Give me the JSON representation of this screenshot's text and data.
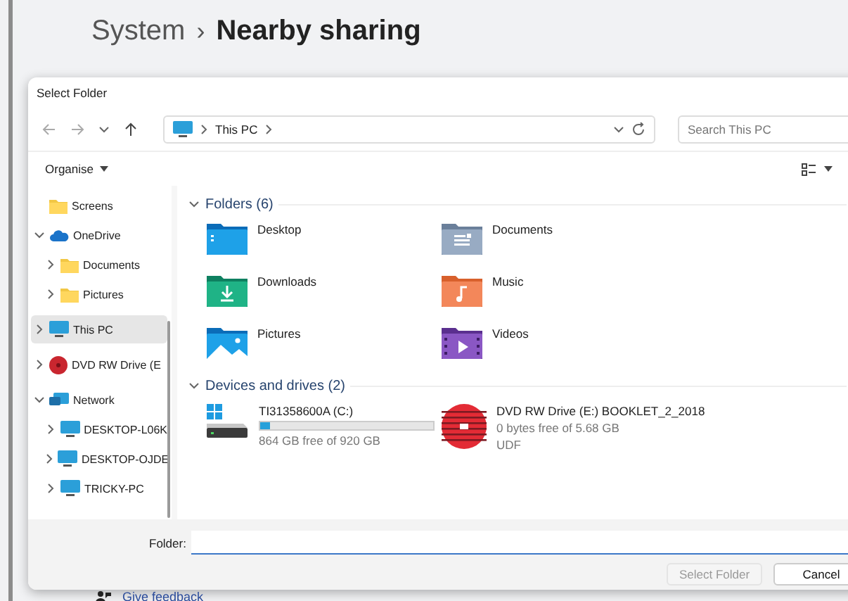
{
  "header": {
    "parent": "System",
    "separator": "›",
    "current": "Nearby sharing"
  },
  "dialog": {
    "title": "Select Folder",
    "address": {
      "location": "This PC"
    },
    "search": {
      "placeholder": "Search This PC"
    },
    "toolbar": {
      "organise": "Organise"
    },
    "sidebar": [
      {
        "label": "Screens",
        "kind": "folder",
        "selected": false
      },
      {
        "label": "OneDrive",
        "kind": "cloud",
        "selected": false,
        "expanded": true,
        "children": [
          {
            "label": "Documents",
            "kind": "folder",
            "selected": false,
            "expanded": false
          },
          {
            "label": "Pictures",
            "kind": "folder",
            "selected": false,
            "expanded": false
          }
        ]
      },
      {
        "label": "This PC",
        "kind": "pc",
        "selected": true,
        "expanded": false
      },
      {
        "label": "DVD RW Drive (E",
        "kind": "dvd",
        "selected": false,
        "expanded": false
      },
      {
        "label": "Network",
        "kind": "network",
        "selected": false,
        "expanded": true,
        "children": [
          {
            "label": "DESKTOP-L06K",
            "kind": "pc",
            "selected": false,
            "expanded": false
          },
          {
            "label": "DESKTOP-OJDE",
            "kind": "pc",
            "selected": false,
            "expanded": false
          },
          {
            "label": "TRICKY-PC",
            "kind": "pc",
            "selected": false,
            "expanded": false
          }
        ]
      }
    ],
    "folders": {
      "title": "Folders (6)",
      "items": [
        {
          "label": "Desktop",
          "kind": "desktop"
        },
        {
          "label": "Documents",
          "kind": "documents"
        },
        {
          "label": "Downloads",
          "kind": "downloads"
        },
        {
          "label": "Music",
          "kind": "music"
        },
        {
          "label": "Pictures",
          "kind": "pictures"
        },
        {
          "label": "Videos",
          "kind": "videos"
        }
      ]
    },
    "drives": {
      "title": "Devices and drives (2)",
      "items": [
        {
          "label": "TI31358600A (C:)",
          "kind": "disk",
          "level": 0.06,
          "free": "864 GB free of 920 GB"
        },
        {
          "label": "DVD RW Drive (E:) BOOKLET_2_2018",
          "kind": "dvd",
          "free": "0 bytes free of 5.68 GB",
          "format": "UDF"
        }
      ]
    },
    "footer": {
      "folder_label": "Folder:",
      "select_button": {
        "label": "Select Folder",
        "disabled": true
      },
      "cancel_button": {
        "label": "Cancel",
        "disabled": false
      }
    }
  },
  "feedback": {
    "label": "Give feedback"
  }
}
